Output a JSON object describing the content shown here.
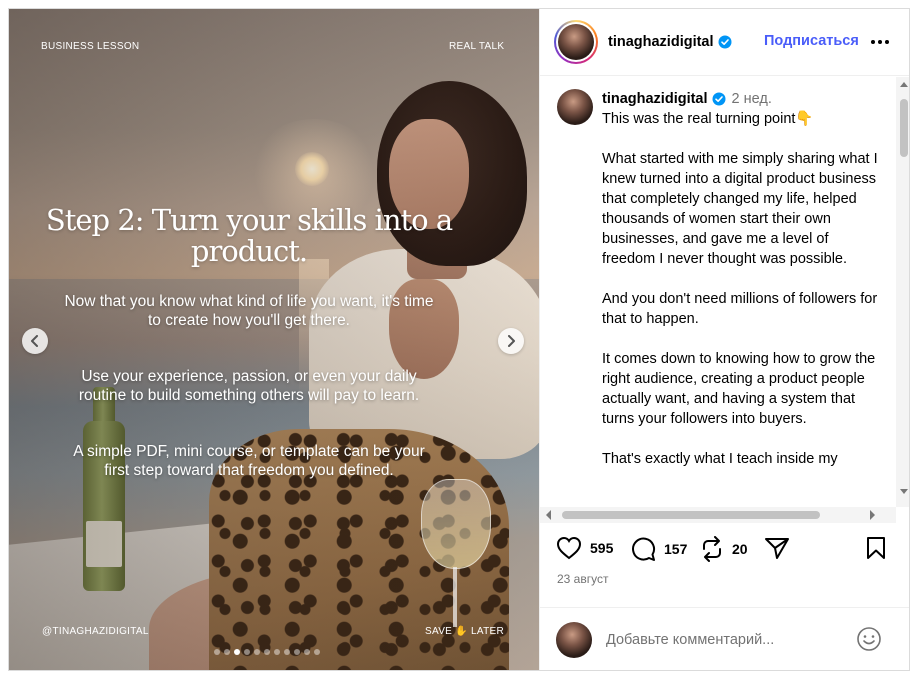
{
  "media": {
    "tag_left": "BUSINESS LESSON",
    "tag_right": "REAL TALK",
    "headline": "Step 2: Turn your skills into a product.",
    "paragraphs": [
      "Now that you know what kind of life you want, it's time to create how you'll get there.",
      "Use your experience, passion, or even your daily routine to build something others will pay to learn.",
      "A simple PDF, mini course, or template can be your first step toward that freedom you defined."
    ],
    "handle": "@TINAGHAZIDIGITAL",
    "save_later": "SAVE ✋ LATER",
    "slide_count": 11,
    "active_slide": 3
  },
  "header": {
    "username": "tinaghazidigital",
    "follow_label": "Подписаться"
  },
  "caption": {
    "username": "tinaghazidigital",
    "time": "2 нед.",
    "paragraphs": [
      "This was the real turning point👇",
      "What started with me simply sharing what I knew turned into a digital product business that completely changed my life, helped thousands of women start their own businesses, and gave me a level of freedom I never thought was possible.",
      "And you don't need millions of followers for that to happen.",
      "It comes down to knowing how to grow the right audience, creating a product people actually want, and having a system that turns your followers into buyers.",
      "That's exactly what I teach inside my"
    ]
  },
  "actions": {
    "likes": "595",
    "comments": "157",
    "reposts": "20"
  },
  "post_date": "23 август",
  "comment": {
    "placeholder": "Добавьте комментарий..."
  },
  "colors": {
    "accent_blue": "#4a5df9",
    "verified_blue": "#0095f6",
    "muted_text": "#737373"
  }
}
